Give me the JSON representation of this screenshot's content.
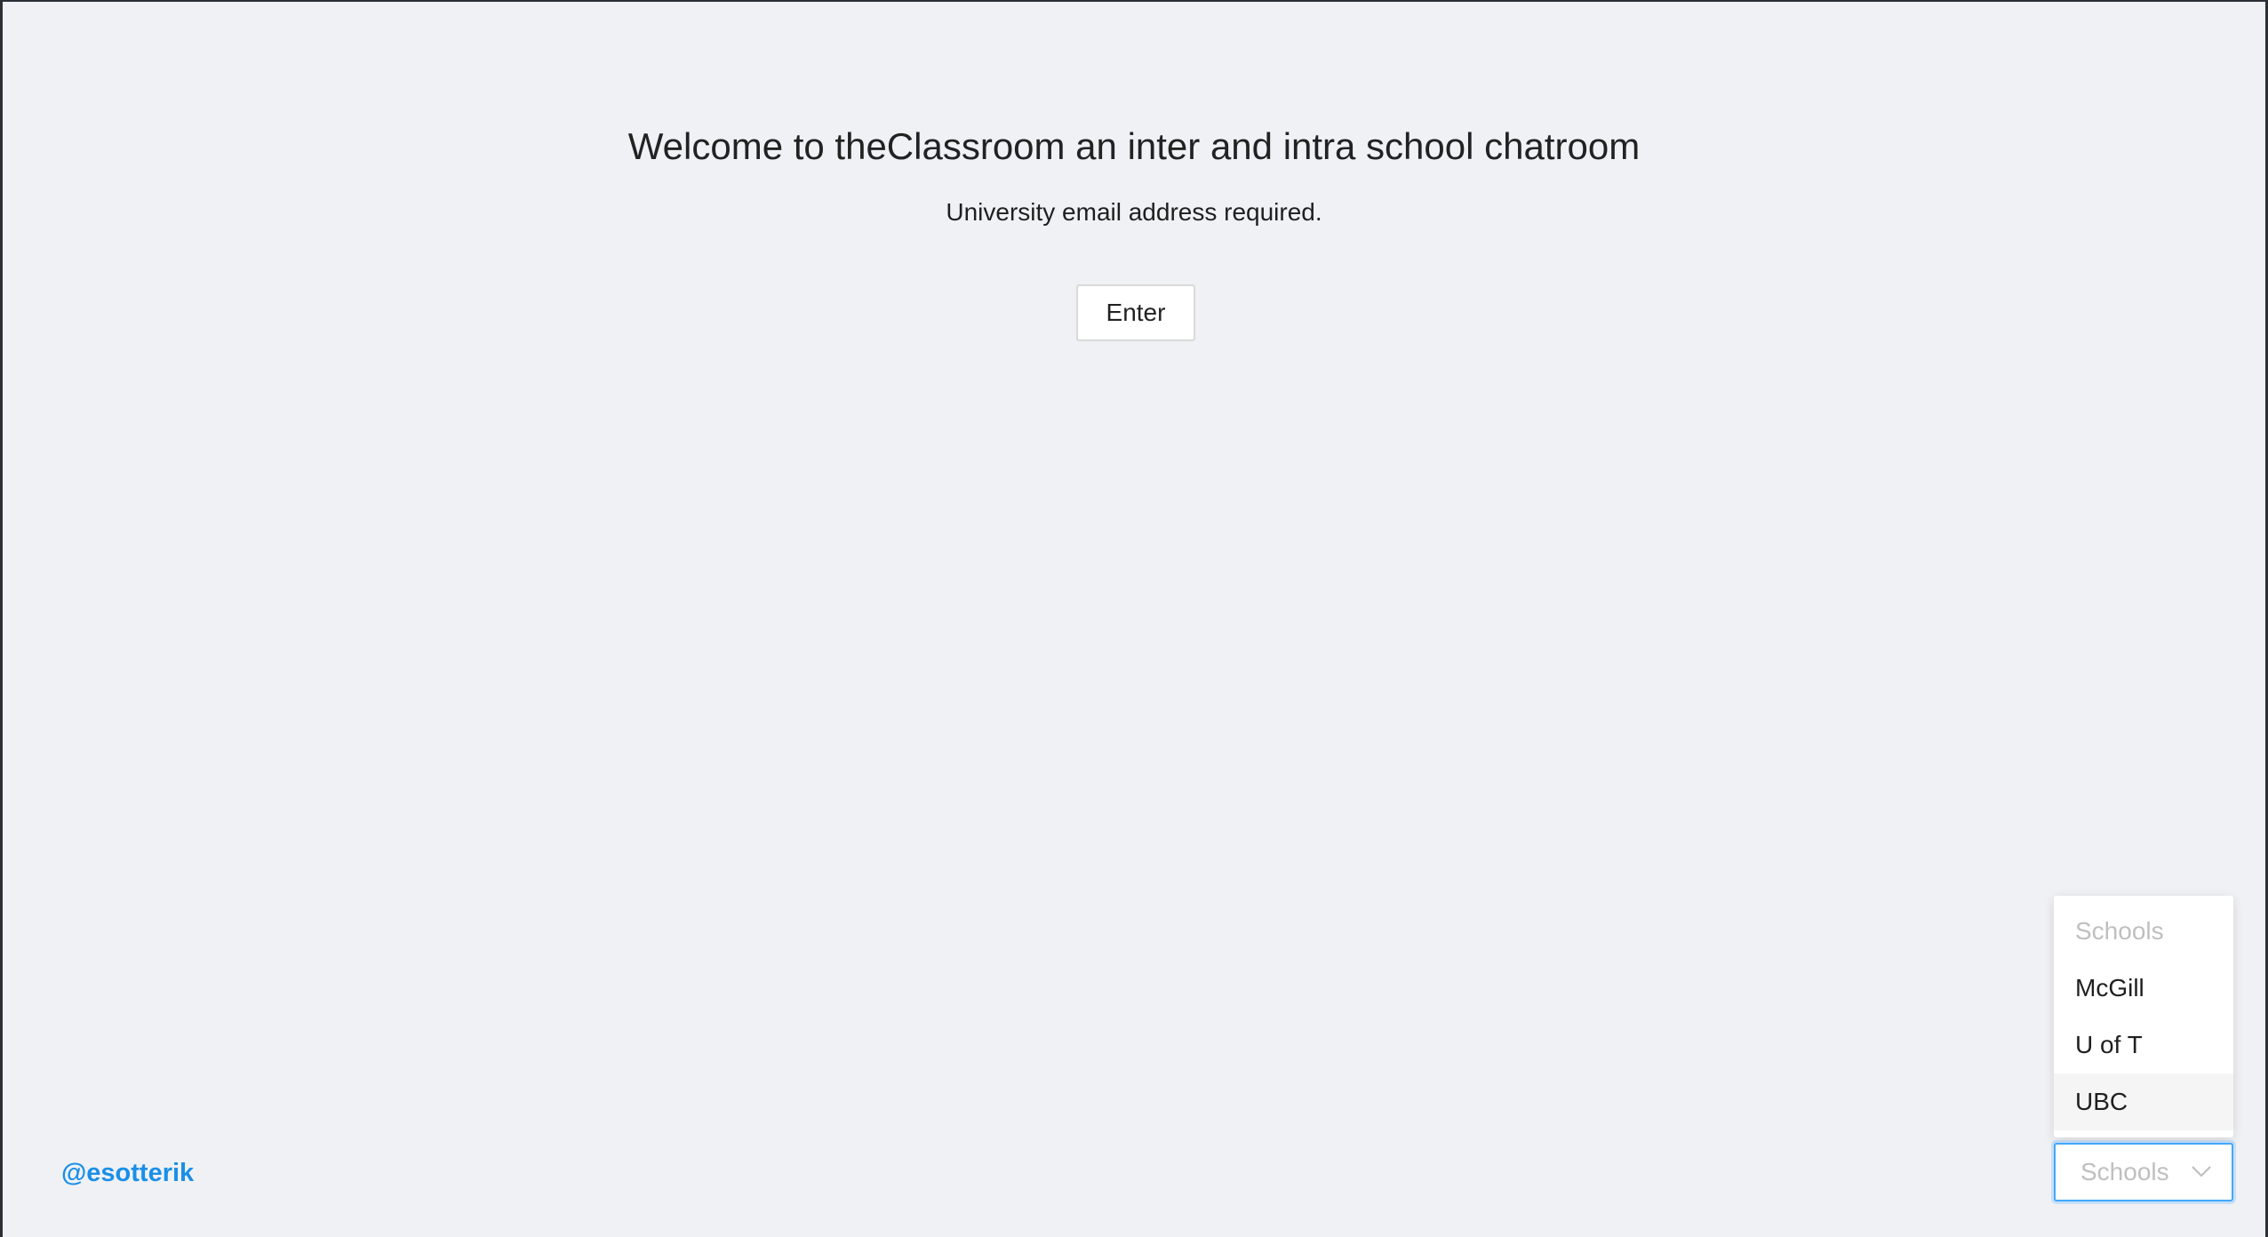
{
  "main": {
    "title": "Welcome to theClassroom an inter and intra school chatroom",
    "subtitle": "University email address required.",
    "enter_label": "Enter"
  },
  "footer": {
    "author_handle": "@esotterik"
  },
  "school_select": {
    "selected_value": "Schools",
    "expanded": true,
    "options": [
      {
        "label": "Schools",
        "placeholder": true
      },
      {
        "label": "McGill"
      },
      {
        "label": "U of T"
      },
      {
        "label": "UBC",
        "highlighted": true
      }
    ]
  },
  "colors": {
    "background": "#f0f1f5",
    "link": "#1a8fe8",
    "focus_border": "#40a9ff",
    "placeholder_text": "#bfbfbf"
  },
  "icons": {
    "select_arrow": "chevron-down-icon"
  }
}
